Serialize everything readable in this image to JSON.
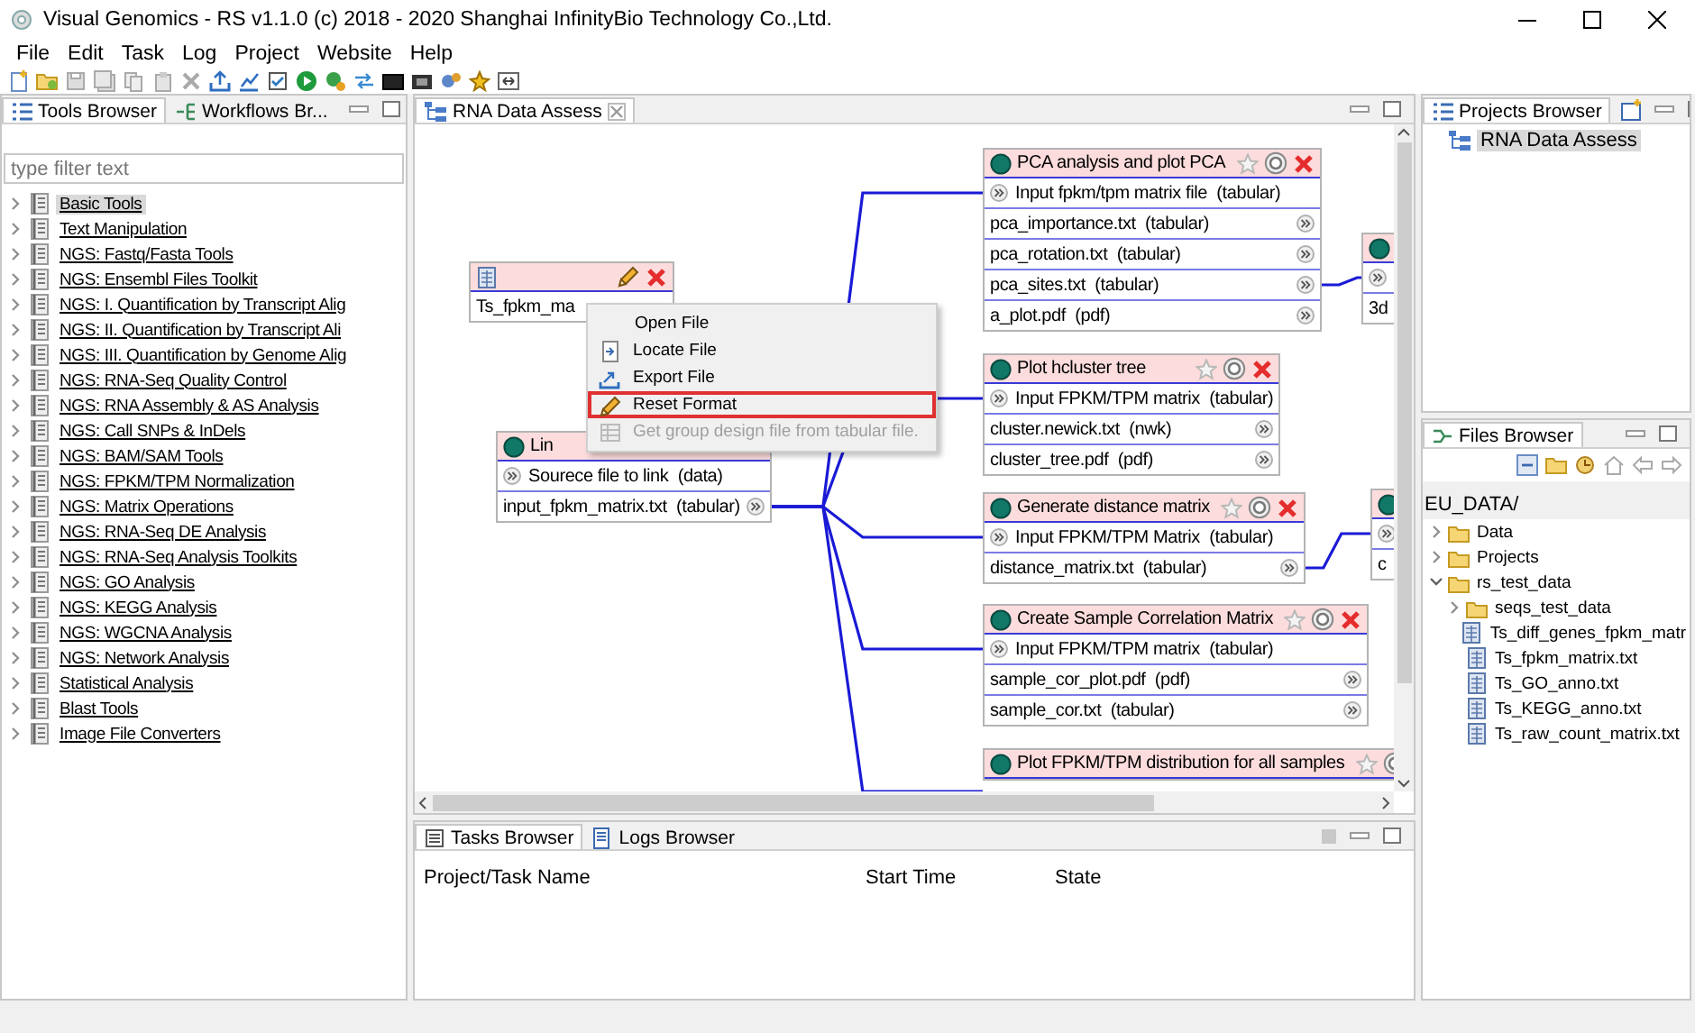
{
  "window": {
    "title": "Visual Genomics - RS v1.1.0 (c) 2018 - 2020 Shanghai InfinityBio Technology Co.,Ltd."
  },
  "menu": [
    "File",
    "Edit",
    "Task",
    "Log",
    "Project",
    "Website",
    "Help"
  ],
  "tools_browser": {
    "tabs": [
      {
        "label": "Tools Browser",
        "selected": true
      },
      {
        "label": "Workflows Br...",
        "selected": false
      }
    ],
    "filter": {
      "placeholder": "type filter text"
    },
    "items": [
      {
        "label": "Basic Tools",
        "selected": true
      },
      {
        "label": "Text Manipulation",
        "selected": false
      },
      {
        "label": "NGS: Fastq/Fasta Tools",
        "selected": false
      },
      {
        "label": "NGS: Ensembl Files Toolkit",
        "selected": false
      },
      {
        "label": "NGS: I. Quantification by Transcript Alig",
        "selected": false
      },
      {
        "label": "NGS: II. Quantification by Transcript Ali",
        "selected": false
      },
      {
        "label": "NGS: III. Quantification by Genome Alig",
        "selected": false
      },
      {
        "label": "NGS: RNA-Seq Quality Control",
        "selected": false
      },
      {
        "label": "NGS: RNA Assembly & AS Analysis",
        "selected": false
      },
      {
        "label": "NGS: Call SNPs & InDels",
        "selected": false
      },
      {
        "label": "NGS: BAM/SAM Tools",
        "selected": false
      },
      {
        "label": "NGS: FPKM/TPM Normalization",
        "selected": false
      },
      {
        "label": "NGS: Matrix Operations",
        "selected": false
      },
      {
        "label": "NGS: RNA-Seq DE Analysis",
        "selected": false
      },
      {
        "label": "NGS: RNA-Seq Analysis Toolkits",
        "selected": false
      },
      {
        "label": "NGS: GO Analysis",
        "selected": false
      },
      {
        "label": "NGS: KEGG Analysis",
        "selected": false
      },
      {
        "label": "NGS: WGCNA Analysis",
        "selected": false
      },
      {
        "label": "NGS: Network Analysis",
        "selected": false
      },
      {
        "label": "Statistical Analysis",
        "selected": false
      },
      {
        "label": "Blast Tools",
        "selected": false
      },
      {
        "label": "Image File Converters",
        "selected": false
      }
    ]
  },
  "editor": {
    "tabs": [
      {
        "label": "RNA Data Assess",
        "selected": true
      }
    ],
    "nodes": [
      {
        "kind": "data",
        "label": "Ts_fpkm_ma"
      },
      {
        "kind": "tool",
        "title": "Lin",
        "controls": false,
        "inputs": [
          "Sourece file to link  (data)"
        ],
        "outputs": [
          "input_fpkm_matrix.txt  (tabular)"
        ]
      },
      {
        "kind": "tool",
        "title": "PCA analysis and plot PCA",
        "controls": true,
        "inputs": [
          "Input fpkm/tpm matrix file  (tabular)"
        ],
        "outputs": [
          "pca_importance.txt  (tabular)",
          "pca_rotation.txt  (tabular)",
          "pca_sites.txt  (tabular)",
          "a_plot.pdf  (pdf)"
        ]
      },
      {
        "kind": "tool",
        "title": "Plot hcluster tree",
        "controls": true,
        "inputs": [
          "Input FPKM/TPM matrix  (tabular)"
        ],
        "outputs": [
          "cluster.newick.txt  (nwk)",
          "cluster_tree.pdf  (pdf)"
        ]
      },
      {
        "kind": "tool",
        "title": "Generate distance matrix",
        "controls": true,
        "inputs": [
          "Input FPKM/TPM Matrix  (tabular)"
        ],
        "outputs": [
          "distance_matrix.txt  (tabular)"
        ]
      },
      {
        "kind": "tool",
        "title": "Create Sample Correlation Matrix",
        "controls": true,
        "inputs": [
          "Input FPKM/TPM matrix  (tabular)"
        ],
        "outputs": [
          "sample_cor_plot.pdf  (pdf)",
          "sample_cor.txt  (tabular)"
        ]
      },
      {
        "kind": "tool",
        "title": "Plot FPKM/TPM distribution for all samples",
        "controls": true
      },
      {
        "kind": "stub",
        "outputs": [
          "3d"
        ]
      },
      {
        "kind": "stub",
        "outputs": [
          "c"
        ]
      }
    ],
    "context_menu": {
      "items": [
        {
          "label": "Open File",
          "kind": "plain",
          "disabled": false,
          "highlighted": false
        },
        {
          "label": "Locate File",
          "kind": "locate",
          "disabled": false,
          "highlighted": false
        },
        {
          "label": "Export File",
          "kind": "export",
          "disabled": false,
          "highlighted": false
        },
        {
          "label": "Reset Format",
          "kind": "edit",
          "disabled": false,
          "highlighted": true
        },
        {
          "label": "Get group design file from tabular file.",
          "kind": "table",
          "disabled": true,
          "highlighted": false
        }
      ]
    }
  },
  "tasks": {
    "tabs": [
      {
        "label": "Tasks Browser",
        "selected": true
      },
      {
        "label": "Logs Browser",
        "selected": false
      }
    ],
    "columns": [
      "Project/Task Name",
      "Start Time",
      "State"
    ]
  },
  "projects_browser": {
    "title": "Projects Browser",
    "items": [
      {
        "label": "RNA Data Assess",
        "selected": true
      }
    ]
  },
  "files_browser": {
    "title": "Files Browser",
    "root": "EU_DATA/",
    "tree": [
      {
        "label": "Data",
        "kind": "folder",
        "expanded": false
      },
      {
        "label": "Projects",
        "kind": "folder",
        "expanded": false
      },
      {
        "label": "rs_test_data",
        "kind": "folder",
        "expanded": true,
        "children": [
          {
            "label": "seqs_test_data",
            "kind": "folder",
            "expanded": false
          },
          {
            "label": "Ts_diff_genes_fpkm_matr",
            "kind": "file"
          },
          {
            "label": "Ts_fpkm_matrix.txt",
            "kind": "file"
          },
          {
            "label": "Ts_GO_anno.txt",
            "kind": "file"
          },
          {
            "label": "Ts_KEGG_anno.txt",
            "kind": "file"
          },
          {
            "label": "Ts_raw_count_matrix.txt",
            "kind": "file"
          }
        ]
      }
    ]
  }
}
